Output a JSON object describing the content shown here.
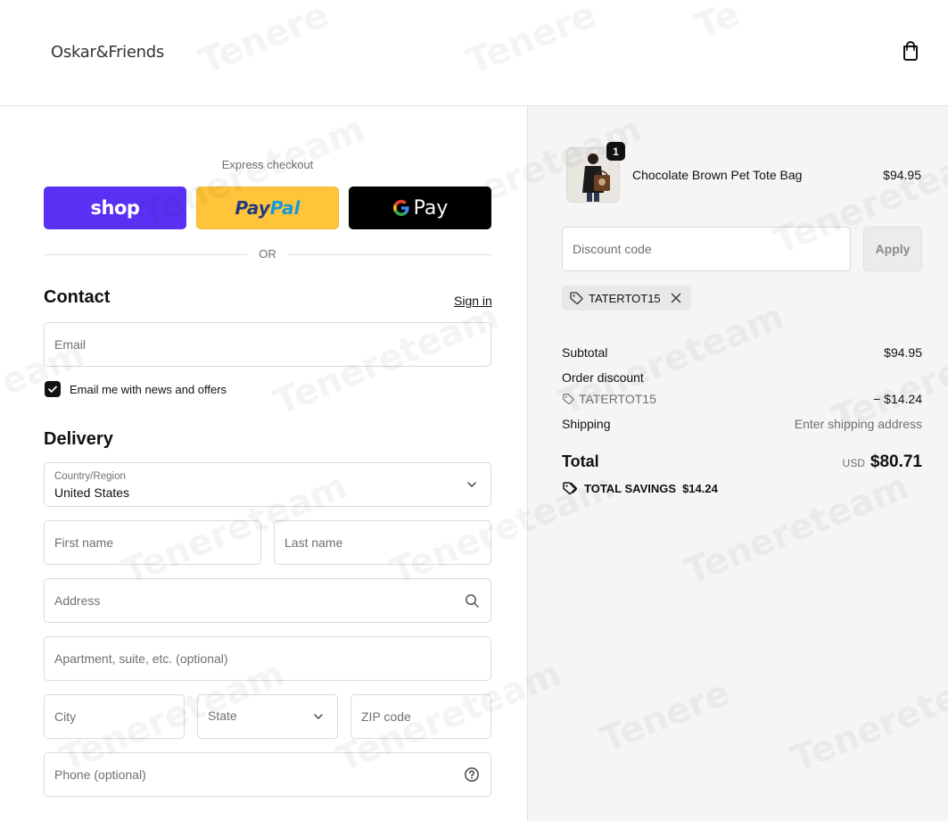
{
  "header": {
    "logo": "Oskar&Friends"
  },
  "express": {
    "title": "Express checkout",
    "shop_label": "shop",
    "paypal_part1": "Pay",
    "paypal_part2": "Pal",
    "gpay_label": "Pay",
    "or_label": "OR"
  },
  "contact": {
    "title": "Contact",
    "signin": "Sign in",
    "email_placeholder": "Email",
    "newsletter_label": "Email me with news and offers",
    "newsletter_checked": true
  },
  "delivery": {
    "title": "Delivery",
    "country_label": "Country/Region",
    "country_value": "United States",
    "first_name": "First name",
    "last_name": "Last name",
    "address": "Address",
    "apartment": "Apartment, suite, etc. (optional)",
    "city": "City",
    "state": "State",
    "zip": "ZIP code",
    "phone": "Phone (optional)"
  },
  "order": {
    "item": {
      "name": "Chocolate Brown Pet Tote Bag",
      "price": "$94.95",
      "quantity": "1"
    },
    "discount_placeholder": "Discount code",
    "apply_label": "Apply",
    "applied_code": "TATERTOT15",
    "subtotal_label": "Subtotal",
    "subtotal_value": "$94.95",
    "order_discount_label": "Order discount",
    "discount_code": "TATERTOT15",
    "discount_value": "− $14.24",
    "shipping_label": "Shipping",
    "shipping_value": "Enter shipping address",
    "total_label": "Total",
    "currency": "USD",
    "total_value": "$80.71",
    "savings_label": "TOTAL SAVINGS",
    "savings_value": "$14.24"
  },
  "colors": {
    "shop": "#5a31f4",
    "paypal": "#ffc439",
    "gpay": "#000000"
  }
}
